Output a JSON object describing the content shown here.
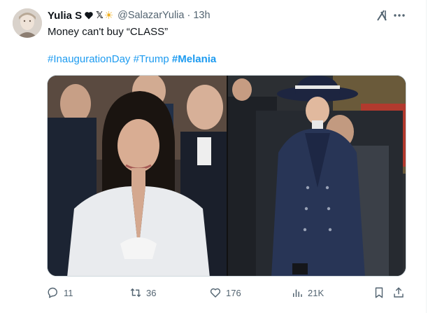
{
  "tweet": {
    "display_name": "Yulia S",
    "badge_text": "𝕏",
    "handle": "@SalazarYulia",
    "separator": "·",
    "time": "13h",
    "text": "Money can't buy “CLASS”",
    "hashtags": [
      {
        "text": "#InaugurationDay",
        "bold": false
      },
      {
        "text": "#Trump",
        "bold": false
      },
      {
        "text": "#Melania",
        "bold": true
      }
    ]
  },
  "actions": {
    "reply_count": "11",
    "repost_count": "36",
    "like_count": "176",
    "views_count": "21K"
  },
  "icons": {
    "grok": "grok-icon",
    "more": "more-icon",
    "reply": "reply-icon",
    "repost": "repost-icon",
    "like": "heart-icon",
    "views": "views-icon",
    "bookmark": "bookmark-icon",
    "share": "share-icon"
  },
  "colors": {
    "accent": "#1d9bf0",
    "text": "#0f1419",
    "muted": "#536471",
    "sun_badge": "#f2b01e"
  }
}
